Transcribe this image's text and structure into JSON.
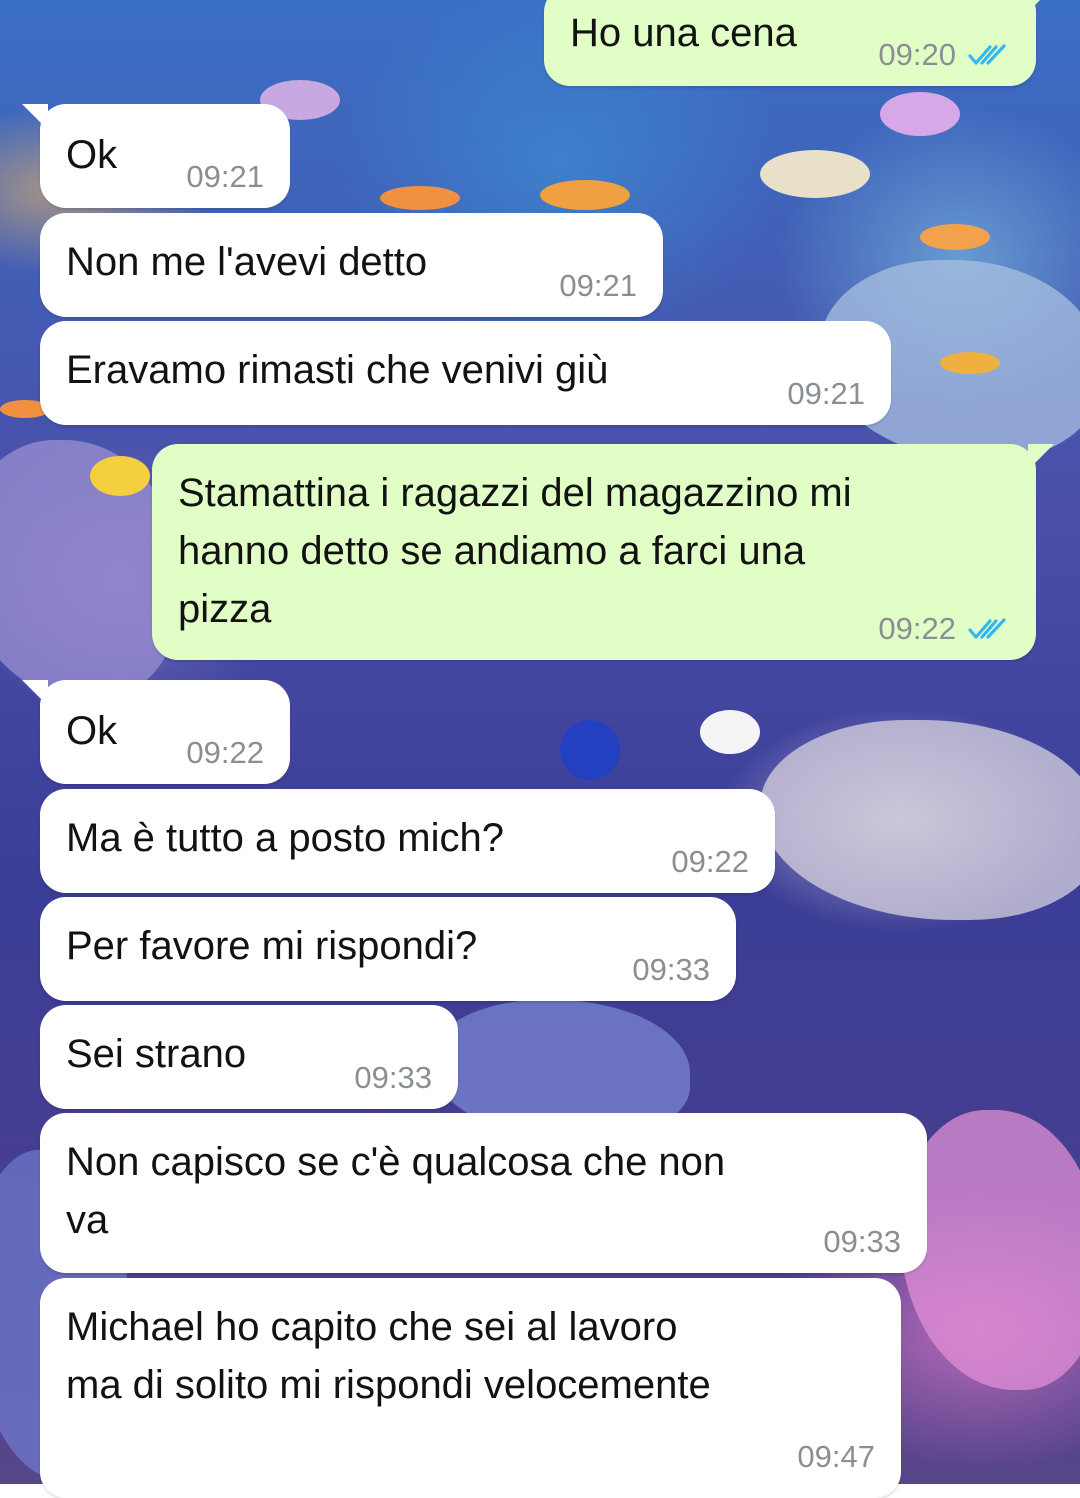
{
  "theme": {
    "incoming_bubble": "#ffffff",
    "outgoing_bubble": "#e1fec6",
    "timestamp_color": "#8a8f94",
    "read_tick_color": "#34b7f1"
  },
  "wallpaper": {
    "description_icon": "aquarium-wallpaper"
  },
  "messages": [
    {
      "direction": "outgoing",
      "text": "Ho una cena",
      "time": "09:20",
      "status": "read"
    },
    {
      "direction": "incoming",
      "text": "Ok",
      "time": "09:21"
    },
    {
      "direction": "incoming",
      "text": "Non me l'avevi detto",
      "time": "09:21"
    },
    {
      "direction": "incoming",
      "text": "Eravamo rimasti che venivi giù",
      "time": "09:21"
    },
    {
      "direction": "outgoing",
      "text": "Stamattina i ragazzi del magazzino mi\nhanno detto se andiamo a farci una\npizza",
      "time": "09:22",
      "status": "read"
    },
    {
      "direction": "incoming",
      "text": "Ok",
      "time": "09:22"
    },
    {
      "direction": "incoming",
      "text": "Ma è tutto a posto mich?",
      "time": "09:22"
    },
    {
      "direction": "incoming",
      "text": "Per favore mi rispondi?",
      "time": "09:33"
    },
    {
      "direction": "incoming",
      "text": "Sei strano",
      "time": "09:33"
    },
    {
      "direction": "incoming",
      "text": "Non capisco se c'è qualcosa che non\nva",
      "time": "09:33"
    },
    {
      "direction": "incoming",
      "text": "Michael ho capito che sei al lavoro\nma di solito mi rispondi velocemente",
      "time": "09:47"
    }
  ]
}
